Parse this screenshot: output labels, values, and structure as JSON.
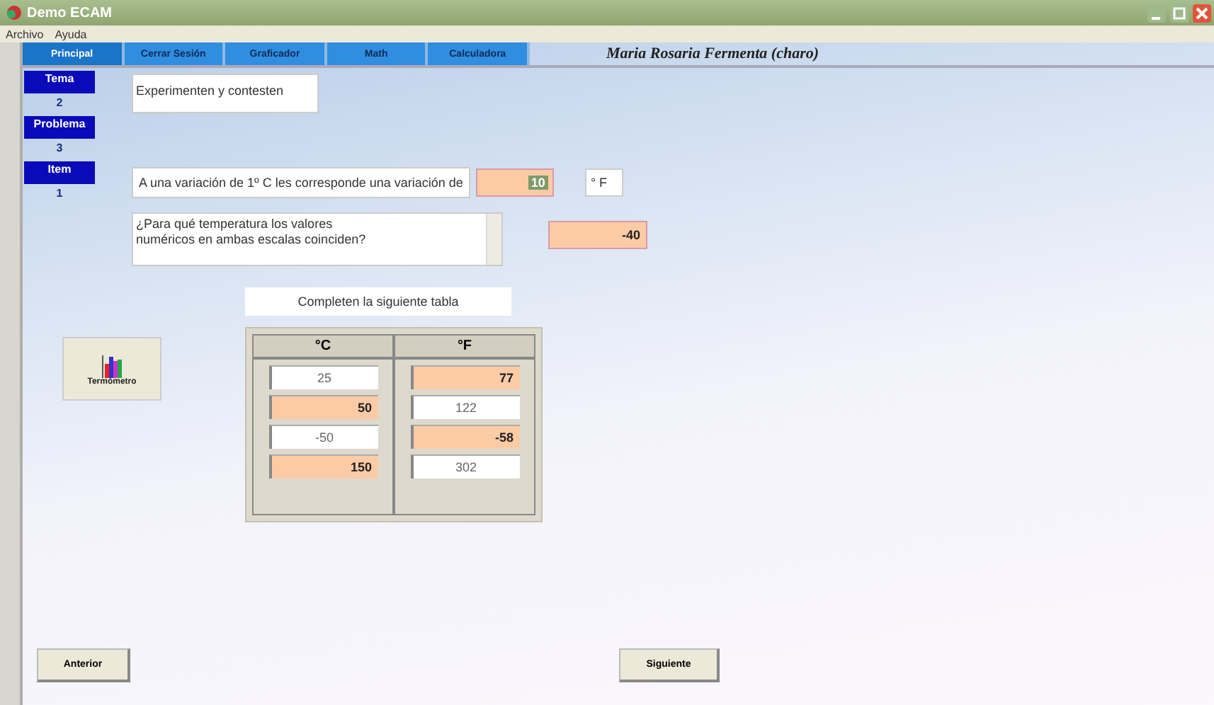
{
  "window": {
    "title": "Demo ECAM"
  },
  "menu": [
    "Archivo",
    "Ayuda"
  ],
  "tabs": [
    {
      "label": "Principal",
      "selected": true
    },
    {
      "label": "Cerrar Sesión",
      "selected": false
    },
    {
      "label": "Graficador",
      "selected": false
    },
    {
      "label": "Math",
      "selected": false
    },
    {
      "label": "Calculadora",
      "selected": false
    }
  ],
  "user": "Maria Rosaria Fermenta  (charo)",
  "sidebar": [
    {
      "label": "Tema",
      "value": "2"
    },
    {
      "label": "Problema",
      "value": "3"
    },
    {
      "label": "Item",
      "value": "1"
    }
  ],
  "instruction": "Experimenten y contesten",
  "question_1": {
    "text": "A una variación de  1º C les corresponde una variación de",
    "answer": "10",
    "text_selected": true,
    "unit": "° F"
  },
  "question_2": {
    "text": "¿Para qué temperatura los valores numéricos en ambas escalas coinciden?",
    "answer": "-40"
  },
  "thermometer_button": "Termómetro",
  "table": {
    "caption": "Completen la siguiente tabla",
    "columns": [
      "°C",
      "°F"
    ],
    "rows": [
      [
        {
          "value": "25",
          "kind": "given"
        },
        {
          "value": "77",
          "kind": "answer"
        }
      ],
      [
        {
          "value": "50",
          "kind": "answer"
        },
        {
          "value": "122",
          "kind": "given"
        }
      ],
      [
        {
          "value": "-50",
          "kind": "given"
        },
        {
          "value": "-58",
          "kind": "answer"
        }
      ],
      [
        {
          "value": "150",
          "kind": "answer"
        },
        {
          "value": "302",
          "kind": "given"
        }
      ]
    ]
  },
  "buttons": {
    "previous": "Anterior",
    "next": "Siguiente"
  }
}
